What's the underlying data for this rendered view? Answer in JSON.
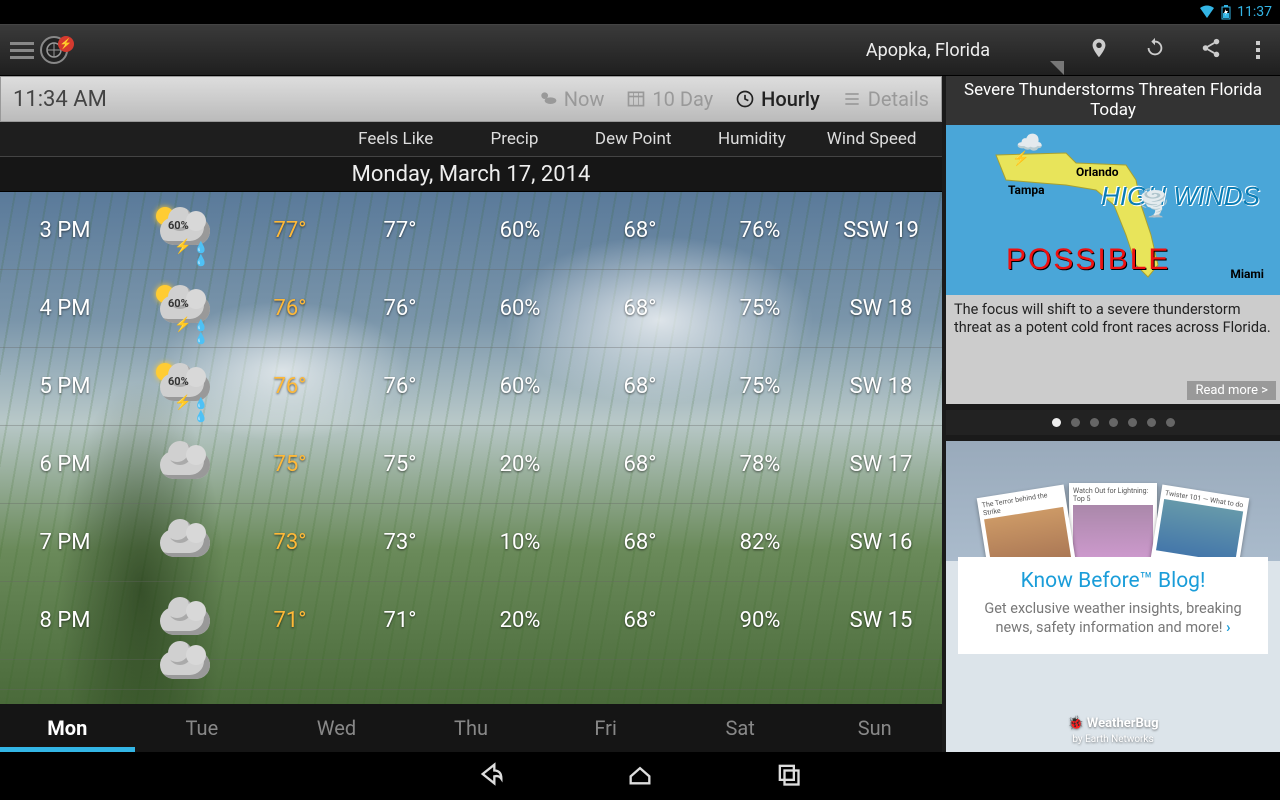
{
  "statusbar": {
    "time": "11:37"
  },
  "actionbar": {
    "location": "Apopka, Florida"
  },
  "subheader": {
    "time": "11:34 AM",
    "tabs": {
      "now": "Now",
      "tenday": "10 Day",
      "hourly": "Hourly",
      "details": "Details"
    }
  },
  "columns": {
    "feels": "Feels Like",
    "precip": "Precip",
    "dew": "Dew Point",
    "humid": "Humidity",
    "wind": "Wind Speed"
  },
  "dateBanner": "Monday, March 17, 2014",
  "hours": [
    {
      "time": "3 PM",
      "icon": "storm",
      "pct": "60%",
      "temp": "77°",
      "feels": "77°",
      "precip": "60%",
      "dew": "68°",
      "humid": "76%",
      "wind": "SSW 19"
    },
    {
      "time": "4 PM",
      "icon": "storm",
      "pct": "60%",
      "temp": "76°",
      "feels": "76°",
      "precip": "60%",
      "dew": "68°",
      "humid": "75%",
      "wind": "SW 18"
    },
    {
      "time": "5 PM",
      "icon": "storm",
      "pct": "60%",
      "temp": "76°",
      "feels": "76°",
      "precip": "60%",
      "dew": "68°",
      "humid": "75%",
      "wind": "SW 18"
    },
    {
      "time": "6 PM",
      "icon": "cloud",
      "pct": "",
      "temp": "75°",
      "feels": "75°",
      "precip": "20%",
      "dew": "68°",
      "humid": "78%",
      "wind": "SW 17"
    },
    {
      "time": "7 PM",
      "icon": "cloud",
      "pct": "",
      "temp": "73°",
      "feels": "73°",
      "precip": "10%",
      "dew": "68°",
      "humid": "82%",
      "wind": "SW 16"
    },
    {
      "time": "8 PM",
      "icon": "cloud",
      "pct": "",
      "temp": "71°",
      "feels": "71°",
      "precip": "20%",
      "dew": "68°",
      "humid": "90%",
      "wind": "SW 15"
    }
  ],
  "days": [
    "Mon",
    "Tue",
    "Wed",
    "Thu",
    "Fri",
    "Sat",
    "Sun"
  ],
  "alert": {
    "headline": "Severe Thunderstorms Threaten Florida Today",
    "map": {
      "orlando": "Orlando",
      "tampa": "Tampa",
      "miami": "Miami",
      "highwinds": "HIGH WINDS",
      "possible": "POSSIBLE"
    },
    "summary": "The focus will shift to a severe thunderstorm threat as a potent cold front races across Florida.",
    "readmore": "Read more >"
  },
  "blog": {
    "title": "Know Before™ Blog!",
    "desc": "Get exclusive weather insights, breaking news, safety information and more!",
    "footer_brand": "WeatherBug",
    "footer_by": "by Earth Networks"
  }
}
